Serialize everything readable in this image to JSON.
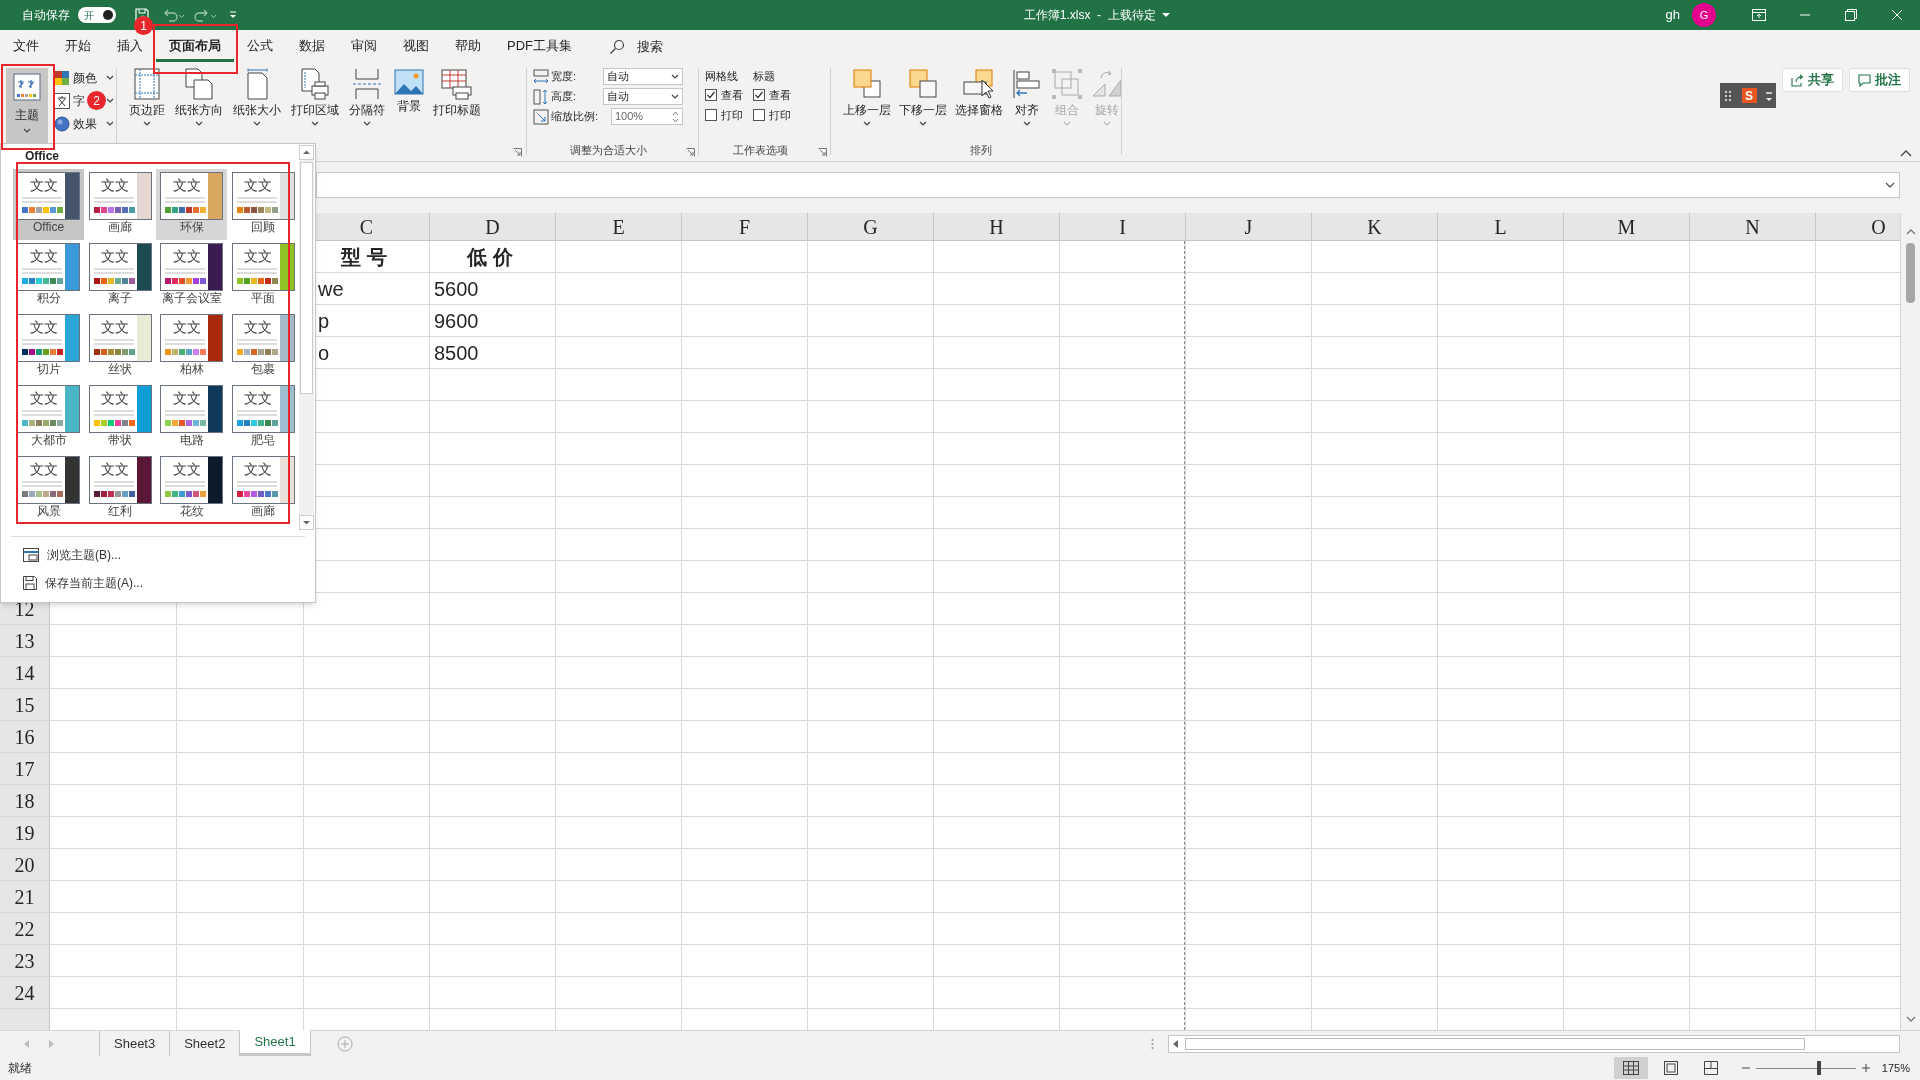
{
  "title_bar": {
    "autosave_label": "自动保存",
    "autosave_toggle": {
      "label": "开",
      "on": true
    },
    "title": "工作簿1.xlsx  -  上载待定",
    "user": "gh",
    "avatar": "G"
  },
  "ribbon_tabs": [
    {
      "label": "文件",
      "selected": false
    },
    {
      "label": "开始",
      "selected": false
    },
    {
      "label": "插入",
      "selected": false
    },
    {
      "label": "页面布局",
      "selected": true
    },
    {
      "label": "公式",
      "selected": false
    },
    {
      "label": "数据",
      "selected": false
    },
    {
      "label": "审阅",
      "selected": false
    },
    {
      "label": "视图",
      "selected": false
    },
    {
      "label": "帮助",
      "selected": false
    },
    {
      "label": "PDF工具集",
      "selected": false
    }
  ],
  "search": {
    "label": "搜索"
  },
  "ribbon": {
    "theme_button": {
      "label": "主题",
      "pressed": true
    },
    "theme_options": [
      {
        "kind": "colors",
        "label": "颜色"
      },
      {
        "kind": "fonts",
        "label": "字"
      },
      {
        "kind": "effects",
        "label": "效果"
      }
    ],
    "page_setup": [
      {
        "kind": "margins",
        "label": "页边距",
        "dropdown": true
      },
      {
        "kind": "orientation",
        "label": "纸张方向",
        "dropdown": true
      },
      {
        "kind": "size",
        "label": "纸张大小",
        "dropdown": true
      },
      {
        "kind": "print_area",
        "label": "打印区域",
        "dropdown": true
      },
      {
        "kind": "breaks",
        "label": "分隔符",
        "dropdown": true
      },
      {
        "kind": "background",
        "label": "背景",
        "dropdown": false
      },
      {
        "kind": "print_titles",
        "label": "打印标题",
        "dropdown": false
      }
    ],
    "scale_to_fit": {
      "title": "调整为合适大小",
      "rows": [
        {
          "kind": "dropdown",
          "label": "宽度:",
          "value": "自动"
        },
        {
          "kind": "dropdown",
          "label": "高度:",
          "value": "自动"
        },
        {
          "kind": "spinner",
          "label": "缩放比例:",
          "value": "100%"
        }
      ]
    },
    "sheet_options": {
      "title": "工作表选项",
      "columns": [
        {
          "heading": "网格线",
          "options": [
            {
              "label": "查看",
              "checked": true
            },
            {
              "label": "打印",
              "checked": false
            }
          ]
        },
        {
          "heading": "标题",
          "options": [
            {
              "label": "查看",
              "checked": true
            },
            {
              "label": "打印",
              "checked": false
            }
          ]
        }
      ]
    },
    "arrange": {
      "title": "排列",
      "buttons": [
        {
          "kind": "forward",
          "label": "上移一层",
          "dropdown": true,
          "disabled": false
        },
        {
          "kind": "backward",
          "label": "下移一层",
          "dropdown": true,
          "disabled": false
        },
        {
          "kind": "pane",
          "label": "选择窗格",
          "dropdown": false,
          "disabled": false
        },
        {
          "kind": "align",
          "label": "对齐",
          "dropdown": true,
          "disabled": false
        },
        {
          "kind": "group",
          "label": "组合",
          "dropdown": true,
          "disabled": true
        },
        {
          "kind": "rotate",
          "label": "旋转",
          "dropdown": true,
          "disabled": true
        }
      ]
    }
  },
  "ime_toolbar": {
    "label": "S"
  },
  "share_button": {
    "label": "共享"
  },
  "comments_button": {
    "label": "批注"
  },
  "theme_gallery": {
    "heading": "Office",
    "themes": [
      {
        "name": "Office",
        "sample": "文文",
        "selected": true,
        "hover": false,
        "color": "#44546a",
        "swatches": [
          {
            "color": "#4472c4"
          },
          {
            "color": "#ed7d31"
          },
          {
            "color": "#a5a5a5"
          },
          {
            "color": "#ffc000"
          },
          {
            "color": "#5b9bd5"
          },
          {
            "color": "#70ad47"
          }
        ]
      },
      {
        "name": "画廊",
        "sample": "文文",
        "selected": false,
        "hover": false,
        "color": "#e6d6d2",
        "swatches": [
          {
            "color": "#b71e42"
          },
          {
            "color": "#de478e"
          },
          {
            "color": "#bc72f0"
          },
          {
            "color": "#795faf"
          },
          {
            "color": "#586eb9"
          },
          {
            "color": "#4d9ba1"
          }
        ]
      },
      {
        "name": "环保",
        "sample": "文文",
        "selected": false,
        "hover": true,
        "color": "#d9a860",
        "swatches": [
          {
            "color": "#549e39"
          },
          {
            "color": "#31a380"
          },
          {
            "color": "#3c6da8"
          },
          {
            "color": "#c0392b"
          },
          {
            "color": "#e8702a"
          },
          {
            "color": "#f2b134"
          }
        ]
      },
      {
        "name": "回顾",
        "sample": "文文",
        "selected": false,
        "hover": false,
        "color": "#e0e0e0",
        "swatches": [
          {
            "color": "#e48312"
          },
          {
            "color": "#bd582c"
          },
          {
            "color": "#865640"
          },
          {
            "color": "#9b8357"
          },
          {
            "color": "#c2bc80"
          },
          {
            "color": "#94a088"
          }
        ]
      },
      {
        "name": "积分",
        "sample": "文文",
        "selected": false,
        "hover": false,
        "color": "#3a9ad9",
        "swatches": [
          {
            "color": "#1cade4"
          },
          {
            "color": "#2683c6"
          },
          {
            "color": "#27ced7"
          },
          {
            "color": "#42ba97"
          },
          {
            "color": "#3e8853"
          },
          {
            "color": "#62a39f"
          }
        ]
      },
      {
        "name": "离子",
        "sample": "文文",
        "selected": false,
        "hover": false,
        "color": "#1b4b4f",
        "swatches": [
          {
            "color": "#b01513"
          },
          {
            "color": "#ea6312"
          },
          {
            "color": "#e6b729"
          },
          {
            "color": "#6aac90"
          },
          {
            "color": "#54849a"
          },
          {
            "color": "#9e5e9b"
          }
        ]
      },
      {
        "name": "离子会议室",
        "sample": "文文",
        "selected": false,
        "hover": false,
        "color": "#3a1c52",
        "swatches": [
          {
            "color": "#b3186d"
          },
          {
            "color": "#e22b5c"
          },
          {
            "color": "#e94e2d"
          },
          {
            "color": "#f39b31"
          },
          {
            "color": "#a93fe0"
          },
          {
            "color": "#7f57d9"
          }
        ]
      },
      {
        "name": "平面",
        "sample": "文文",
        "selected": false,
        "hover": false,
        "color": "#90c226",
        "swatches": [
          {
            "color": "#8fc425"
          },
          {
            "color": "#54a021"
          },
          {
            "color": "#e6b91e"
          },
          {
            "color": "#e76618"
          },
          {
            "color": "#c42f1a"
          },
          {
            "color": "#918655"
          }
        ]
      },
      {
        "name": "切片",
        "sample": "文文",
        "selected": false,
        "hover": false,
        "color": "#2aa7d6",
        "swatches": [
          {
            "color": "#052f61"
          },
          {
            "color": "#a50e82"
          },
          {
            "color": "#14967c"
          },
          {
            "color": "#6a9e1f"
          },
          {
            "color": "#e87d37"
          },
          {
            "color": "#c62324"
          }
        ]
      },
      {
        "name": "丝状",
        "sample": "文文",
        "selected": false,
        "hover": false,
        "color": "#e8ecd6",
        "swatches": [
          {
            "color": "#a5300f"
          },
          {
            "color": "#d35f1a"
          },
          {
            "color": "#ab8d3a"
          },
          {
            "color": "#8a8a3a"
          },
          {
            "color": "#7f9a6e"
          },
          {
            "color": "#5fa58c"
          }
        ]
      },
      {
        "name": "柏林",
        "sample": "文文",
        "selected": false,
        "hover": false,
        "color": "#a82a0c",
        "swatches": [
          {
            "color": "#f09415"
          },
          {
            "color": "#c1b56b"
          },
          {
            "color": "#4baf73"
          },
          {
            "color": "#5aa6c0"
          },
          {
            "color": "#d17df9"
          },
          {
            "color": "#fa7e5c"
          }
        ]
      },
      {
        "name": "包裹",
        "sample": "文文",
        "selected": false,
        "hover": false,
        "color": "#a5b9c8",
        "swatches": [
          {
            "color": "#f4a81b"
          },
          {
            "color": "#a7b4c0"
          },
          {
            "color": "#d6652b"
          },
          {
            "color": "#a4a384"
          },
          {
            "color": "#8f7d5c"
          },
          {
            "color": "#b0a48a"
          }
        ]
      },
      {
        "name": "大都市",
        "sample": "文文",
        "selected": false,
        "hover": false,
        "color": "#4ab5c4",
        "swatches": [
          {
            "color": "#4fb4c4"
          },
          {
            "color": "#a9b37d"
          },
          {
            "color": "#8a7f5e"
          },
          {
            "color": "#9ba86b"
          },
          {
            "color": "#6c8a5d"
          },
          {
            "color": "#8fa8a0"
          }
        ]
      },
      {
        "name": "带状",
        "sample": "文文",
        "selected": false,
        "hover": false,
        "color": "#0f9ed5",
        "swatches": [
          {
            "color": "#ffc000"
          },
          {
            "color": "#a5d028"
          },
          {
            "color": "#08cc78"
          },
          {
            "color": "#f24099"
          },
          {
            "color": "#828288"
          },
          {
            "color": "#f56617"
          }
        ]
      },
      {
        "name": "电路",
        "sample": "文文",
        "selected": false,
        "hover": false,
        "color": "#103a5c",
        "swatches": [
          {
            "color": "#92d050"
          },
          {
            "color": "#f4a933"
          },
          {
            "color": "#e8562a"
          },
          {
            "color": "#b266d9"
          },
          {
            "color": "#6eb5d9"
          },
          {
            "color": "#7ab6a4"
          }
        ]
      },
      {
        "name": "肥皂",
        "sample": "文文",
        "selected": false,
        "hover": false,
        "color": "#9dbfd0",
        "swatches": [
          {
            "color": "#1ba1e2"
          },
          {
            "color": "#2382c6"
          },
          {
            "color": "#2ccbe2"
          },
          {
            "color": "#3fb593"
          },
          {
            "color": "#3a8a4f"
          },
          {
            "color": "#5fa39f"
          }
        ]
      },
      {
        "name": "风景",
        "sample": "文文",
        "selected": false,
        "hover": false,
        "color": "#333333",
        "swatches": [
          {
            "color": "#7a7a7a"
          },
          {
            "color": "#9aa9b9"
          },
          {
            "color": "#a8c38a"
          },
          {
            "color": "#c0a98a"
          },
          {
            "color": "#8a6a78"
          },
          {
            "color": "#a86a5a"
          }
        ]
      },
      {
        "name": "红利",
        "sample": "文文",
        "selected": false,
        "hover": false,
        "color": "#5c1738",
        "swatches": [
          {
            "color": "#5a1a3a"
          },
          {
            "color": "#a02040"
          },
          {
            "color": "#c03050"
          },
          {
            "color": "#999999"
          },
          {
            "color": "#6aa0c8"
          },
          {
            "color": "#4060a0"
          }
        ]
      },
      {
        "name": "花纹",
        "sample": "文文",
        "selected": false,
        "hover": false,
        "color": "#0c1a2c",
        "swatches": [
          {
            "color": "#8fc842"
          },
          {
            "color": "#3fb58a"
          },
          {
            "color": "#3c9bd7"
          },
          {
            "color": "#7e5bd1"
          },
          {
            "color": "#d0567a"
          },
          {
            "color": "#e8a13a"
          }
        ]
      },
      {
        "name": "画廊",
        "sample": "文文",
        "selected": false,
        "hover": false,
        "color": "#e8e0d8",
        "swatches": [
          {
            "color": "#d12048"
          },
          {
            "color": "#e84ba0"
          },
          {
            "color": "#b45ae8"
          },
          {
            "color": "#6e5fc4"
          },
          {
            "color": "#4a7ac4"
          },
          {
            "color": "#5a9aa8"
          }
        ]
      }
    ],
    "commands": [
      {
        "kind": "browse",
        "label": "浏览主题(B)..."
      },
      {
        "kind": "save",
        "label": "保存当前主题(A)..."
      }
    ]
  },
  "sheet": {
    "columns": [
      "C",
      "D",
      "E",
      "F",
      "G",
      "H",
      "I",
      "J",
      "K",
      "L",
      "M",
      "N",
      "O"
    ],
    "row_numbers": [
      "12",
      "13",
      "14",
      "15",
      "16",
      "17",
      "18",
      "19",
      "20",
      "21",
      "22",
      "23",
      "24"
    ],
    "rows": [
      {
        "kind": "header",
        "c": "型号",
        "d": "低价"
      },
      {
        "kind": "value",
        "c": "we",
        "d": "5600"
      },
      {
        "kind": "value",
        "c": "p",
        "d": "9600"
      },
      {
        "kind": "value",
        "c": "o",
        "d": "8500"
      }
    ]
  },
  "sheet_tabs": [
    {
      "label": "Sheet3",
      "selected": false
    },
    {
      "label": "Sheet2",
      "selected": false
    },
    {
      "label": "Sheet1",
      "selected": true
    }
  ],
  "status_bar": {
    "status": "就绪",
    "views": [
      {
        "kind": "normal",
        "selected": true
      },
      {
        "kind": "page_layout",
        "selected": false
      },
      {
        "kind": "page_break",
        "selected": false
      }
    ],
    "zoom": {
      "level": 0.63,
      "reading": "175%"
    }
  },
  "annotations": [
    {
      "label": "1"
    },
    {
      "label": "2"
    }
  ]
}
